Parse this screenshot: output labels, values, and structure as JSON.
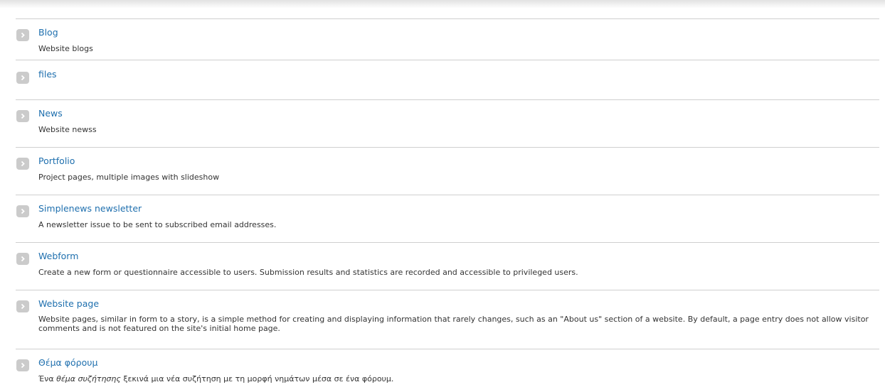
{
  "items": [
    {
      "title": "Blog",
      "description": "Website blogs"
    },
    {
      "title": "files",
      "description": ""
    },
    {
      "title": "News",
      "description": "Website newss"
    },
    {
      "title": "Portfolio",
      "description": "Project pages, multiple images with slideshow"
    },
    {
      "title": "Simplenews newsletter",
      "description": "A newsletter issue to be sent to subscribed email addresses."
    },
    {
      "title": "Webform",
      "description": "Create a new form or questionnaire accessible to users. Submission results and statistics are recorded and accessible to privileged users."
    },
    {
      "title": "Website page",
      "description": "Website pages, similar in form to a story, is a simple method for creating and displaying information that rarely changes, such as an \"About us\" section of a website. By default, a page entry does not allow visitor comments and is not featured on the site's initial home page."
    },
    {
      "title": "Θέμα φόρουμ",
      "description_before": "Ένα ",
      "description_em": "θέμα συζήτησης",
      "description_after": " ξεκινά μια νέα συζήτηση με τη μορφή νημάτων μέσα σε ένα φόρουμ."
    }
  ],
  "icons": {
    "item_arrow": "chevron-right-icon"
  },
  "colors": {
    "link": "#1e6fae",
    "text": "#333333",
    "divider": "#cfcfcf",
    "arrow_bg": "#cbcbcb"
  }
}
